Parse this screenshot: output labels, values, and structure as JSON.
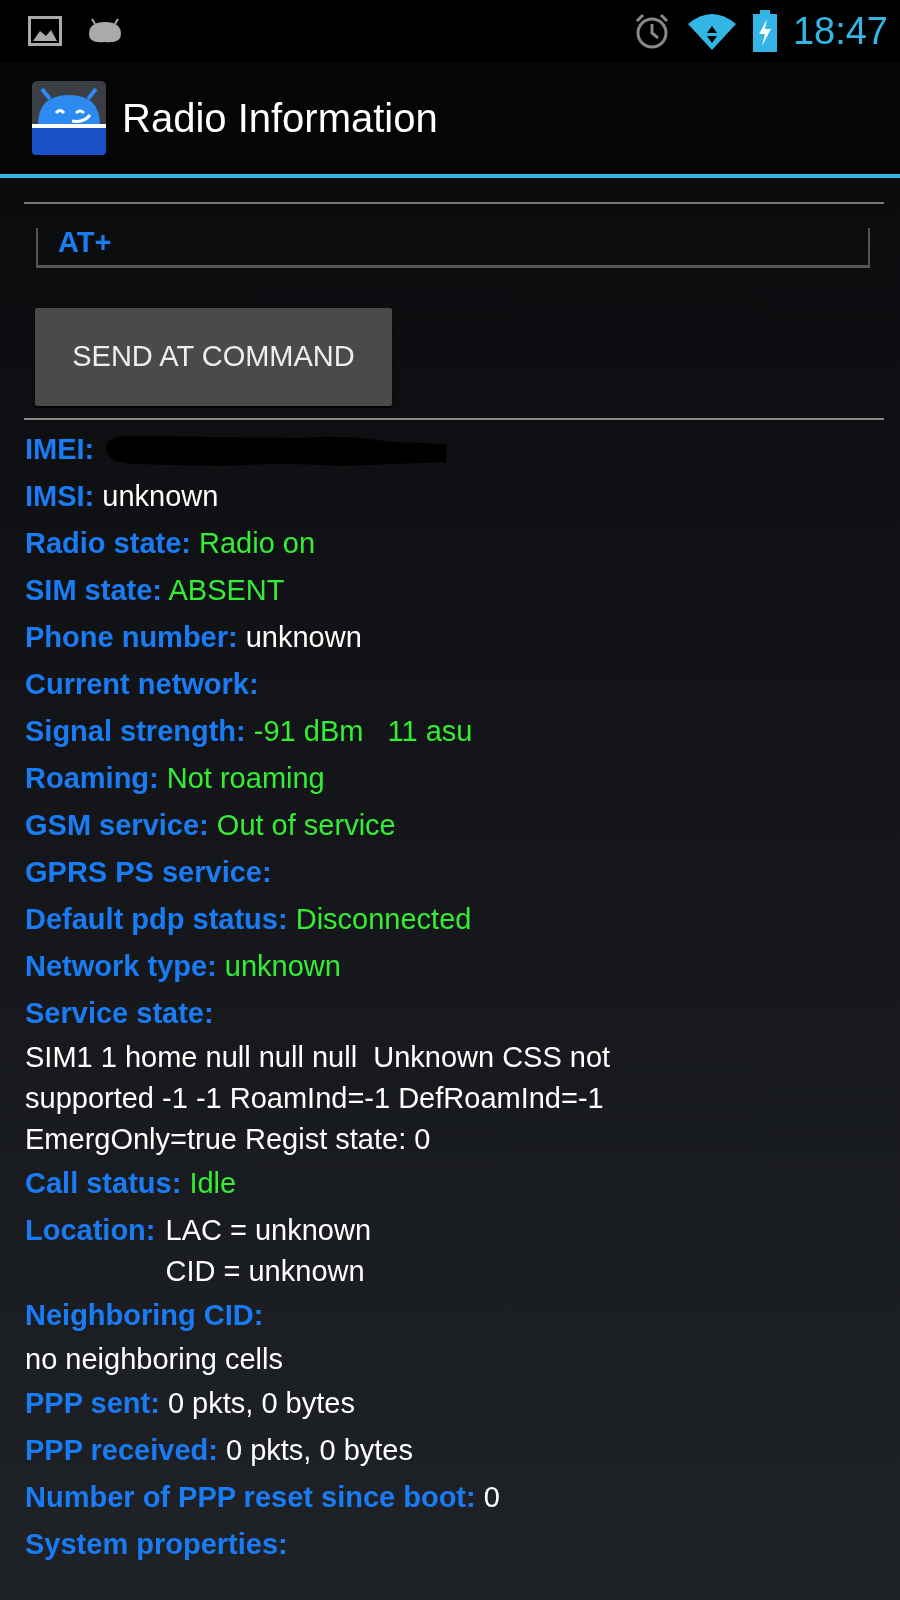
{
  "status_bar": {
    "time": "18:47"
  },
  "action_bar": {
    "title": "Radio Information"
  },
  "command_field": {
    "value": "AT+"
  },
  "send_button": {
    "label": "SEND AT COMMAND"
  },
  "info_rows": [
    {
      "kind": "redacted",
      "label": "IMEI:"
    },
    {
      "kind": "inline",
      "label": "IMSI:",
      "value": "unknown",
      "color": "#ffffff"
    },
    {
      "kind": "inline",
      "label": "Radio state:",
      "value": "Radio on",
      "color": "#33ee33"
    },
    {
      "kind": "inline",
      "label": "SIM state:",
      "value": "ABSENT",
      "color": "#33ee33"
    },
    {
      "kind": "inline",
      "label": "Phone number:",
      "value": "unknown",
      "color": "#ffffff"
    },
    {
      "kind": "label",
      "label": "Current network:"
    },
    {
      "kind": "inline",
      "label": "Signal strength:",
      "value": "-91 dBm   11 asu",
      "color": "#33ee33"
    },
    {
      "kind": "inline",
      "label": "Roaming:",
      "value": "Not roaming",
      "color": "#33ee33"
    },
    {
      "kind": "inline",
      "label": "GSM service:",
      "value": "Out of service",
      "color": "#33ee33"
    },
    {
      "kind": "label",
      "label": "GPRS PS service:"
    },
    {
      "kind": "inline",
      "label": "Default pdp status:",
      "value": "Disconnected",
      "color": "#33ee33"
    },
    {
      "kind": "inline",
      "label": "Network type:",
      "value": "unknown",
      "color": "#33ee33"
    },
    {
      "kind": "block",
      "label": "Service state:",
      "lines": [
        "SIM1 1 home null null null  Unknown CSS not",
        "supported -1 -1 RoamInd=-1 DefRoamInd=-1",
        "EmergOnly=true Regist state: 0"
      ],
      "color": "#ffffff"
    },
    {
      "kind": "inline",
      "label": "Call status:",
      "value": "Idle",
      "color": "#33ee33"
    },
    {
      "kind": "column",
      "label": "Location:",
      "lines": [
        "LAC = unknown",
        "CID = unknown"
      ],
      "color": "#ffffff"
    },
    {
      "kind": "block",
      "label": "Neighboring CID:",
      "lines": [
        "no neighboring cells"
      ],
      "color": "#ffffff"
    },
    {
      "kind": "inline",
      "label": "PPP sent:",
      "value": "0 pkts, 0 bytes",
      "color": "#ffffff"
    },
    {
      "kind": "inline",
      "label": "PPP received:",
      "value": "0 pkts, 0 bytes",
      "color": "#ffffff"
    },
    {
      "kind": "inline",
      "label": "Number of PPP reset since boot:",
      "value": "0",
      "color": "#ffffff"
    },
    {
      "kind": "label",
      "label": "System properties:"
    }
  ]
}
